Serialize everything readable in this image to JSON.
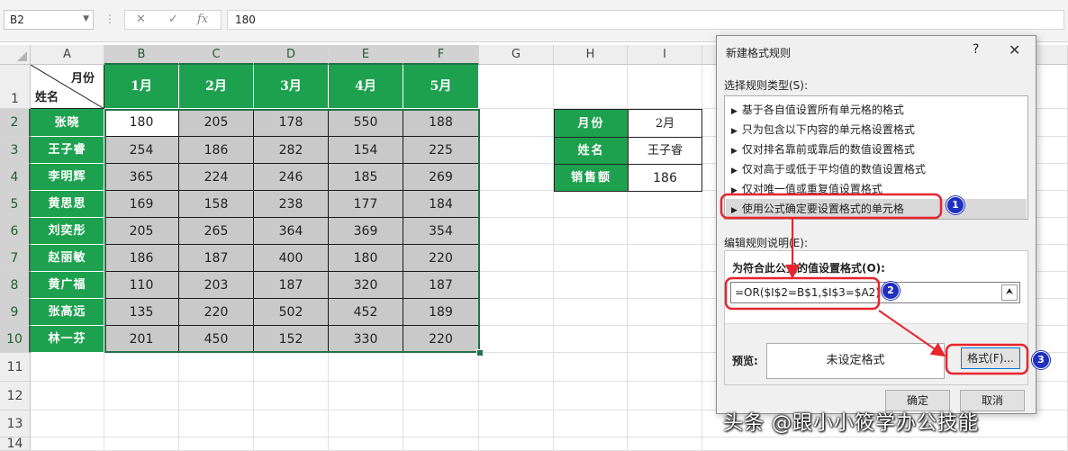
{
  "formula_bar": {
    "name_box": "B2",
    "cancel_icon": "✕",
    "enter_icon": "✓",
    "fx_icon": "fx",
    "formula": "180"
  },
  "columns": [
    "A",
    "B",
    "C",
    "D",
    "E",
    "F",
    "G",
    "H",
    "I",
    "J"
  ],
  "rows": [
    "1",
    "2",
    "3",
    "4",
    "5",
    "6",
    "7",
    "8",
    "9",
    "10",
    "11",
    "12",
    "13",
    "14"
  ],
  "table": {
    "corner_top": "月份",
    "corner_bottom": "姓名",
    "months": [
      "1月",
      "2月",
      "3月",
      "4月",
      "5月"
    ],
    "names": [
      "张晓",
      "王子睿",
      "李明辉",
      "黄思思",
      "刘奕彤",
      "赵丽敏",
      "黄广福",
      "张高远",
      "林一芬"
    ],
    "values": [
      [
        "180",
        "205",
        "178",
        "550",
        "188"
      ],
      [
        "254",
        "186",
        "282",
        "154",
        "225"
      ],
      [
        "365",
        "224",
        "246",
        "185",
        "269"
      ],
      [
        "169",
        "158",
        "238",
        "177",
        "184"
      ],
      [
        "205",
        "265",
        "364",
        "369",
        "354"
      ],
      [
        "186",
        "187",
        "400",
        "180",
        "220"
      ],
      [
        "110",
        "203",
        "187",
        "320",
        "187"
      ],
      [
        "135",
        "220",
        "502",
        "452",
        "189"
      ],
      [
        "201",
        "450",
        "152",
        "330",
        "220"
      ]
    ]
  },
  "lookup": {
    "labels": [
      "月份",
      "姓名",
      "销售额"
    ],
    "values": [
      "2月",
      "王子睿",
      "186"
    ]
  },
  "dialog": {
    "title": "新建格式规则",
    "help": "?",
    "close": "✕",
    "rule_type_label": "选择规则类型(S):",
    "rule_types": [
      "基于各自值设置所有单元格的格式",
      "只为包含以下内容的单元格设置格式",
      "仅对排名靠前或靠后的数值设置格式",
      "仅对高于或低于平均值的数值设置格式",
      "仅对唯一值或重复值设置格式",
      "使用公式确定要设置格式的单元格"
    ],
    "selected_rule_index": 5,
    "edit_label": "编辑规则说明(E):",
    "formula_label": "为符合此公式的值设置格式(O):",
    "formula": "=OR($I$2=B$1,$I$3=$A2)",
    "preview_label": "预览:",
    "preview_text": "未设定格式",
    "format_button": "格式(F)...",
    "ok_button": "确定",
    "cancel_button": "取消"
  },
  "annotations": {
    "steps": [
      "1",
      "2",
      "3"
    ],
    "highlight_color": "#e8242c",
    "badge_color": "#1f2fbf"
  },
  "watermark": "头条 @跟小小筱学办公技能",
  "colors": {
    "header_green": "#1ea14f",
    "excel_green": "#217346",
    "gray_fill": "#c9c9c9"
  }
}
